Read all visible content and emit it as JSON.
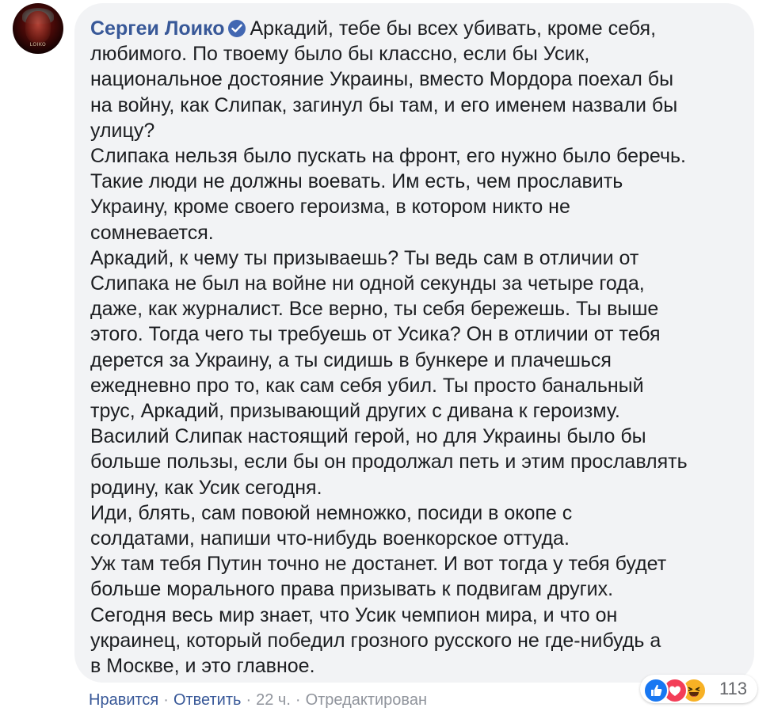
{
  "comment": {
    "author": "Сергеи Лоико",
    "avatar_watermark": "LOIKO",
    "icons": {
      "verified": "verified-badge-icon",
      "like": "like-reaction-icon",
      "love": "love-reaction-icon",
      "haha": "haha-reaction-icon"
    },
    "lines": [
      "Аркадий, тебе бы всех убивать, кроме себя,",
      "любимого. По твоему было бы классно, если бы Усик,",
      "национальное достояние Украины, вместо Мордора поехал бы",
      "на войну, как Слипак, загинул бы там, и его именем назвали бы",
      "улицу?",
      "Слипака нельзя было пускать на фронт, его нужно было беречь.",
      "Такие люди не должны воевать. Им есть, чем прославить",
      "Украину, кроме своего героизма, в котором никто не",
      "сомневается.",
      "Аркадий, к чему ты призываешь? Ты ведь сам в отличии от",
      "Слипака не был на войне ни одной секунды за четыре года,",
      "даже, как журналист. Все верно, ты себя бережешь. Ты выше",
      "этого. Тогда чего ты требуешь от Усика? Он в отличии от тебя",
      "дерется за Украину, а ты сидишь в бункере и плачешься",
      "ежедневно про то, как сам себя убил. Ты просто банальный",
      "трус, Аркадий, призывающий других с дивана к героизму.",
      "Василий Слипак настоящий герой, но для Украины было бы",
      "больше пользы, если бы он продолжал петь и этим прославлять",
      "родину, как Усик сегодня.",
      "Иди, блять, сам повоюй немножко, посиди в окопе с",
      "солдатами, напиши что-нибудь военкорское оттуда.",
      "Уж там тебя Путин точно не достанет. И вот тогда у тебя будет",
      "больше морального права призывать к подвигам других.",
      "Сегодня весь мир знает, что Усик чемпион мира, и что он",
      "украинец, который победил грозного русского не где-нибудь а",
      "в Москве, и это главное."
    ],
    "reactions_count": "113",
    "actions": {
      "like": "Нравится",
      "reply": "Ответить",
      "separator": "·",
      "time": "22 ч.",
      "edited": "Отредактирован"
    },
    "colors": {
      "author": "#385898",
      "bubble": "#f2f3f5",
      "text": "#1c1e21",
      "meta": "#90949c",
      "like": "#1877f2",
      "love": "#f33e58",
      "haha": "#f7b125"
    }
  }
}
